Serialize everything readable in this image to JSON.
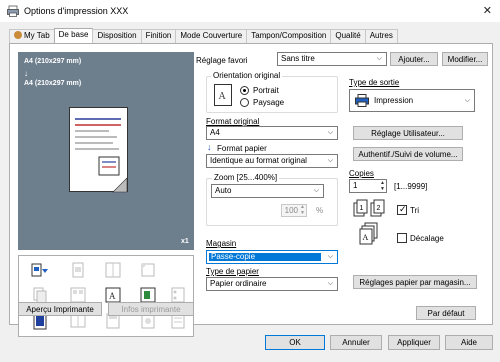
{
  "window": {
    "title": "Options d'impression XXX",
    "close_glyph": "✕"
  },
  "tabs": [
    {
      "label": "My Tab"
    },
    {
      "label": "De base"
    },
    {
      "label": "Disposition"
    },
    {
      "label": "Finition"
    },
    {
      "label": "Mode Couverture"
    },
    {
      "label": "Tampon/Composition"
    },
    {
      "label": "Qualité"
    },
    {
      "label": "Autres"
    }
  ],
  "preview": {
    "paper_label_1": "A4 (210x297 mm)",
    "paper_label_2": "A4 (210x297 mm)",
    "copies_badge": "x1"
  },
  "left_buttons": {
    "preview_printer": "Aperçu Imprimante",
    "printer_info": "Infos imprimante"
  },
  "favorite": {
    "label": "Réglage favori",
    "value": "Sans titre",
    "add": "Ajouter...",
    "modify": "Modifier..."
  },
  "orientation": {
    "title": "Orientation original",
    "portrait": "Portrait",
    "landscape": "Paysage",
    "selected": "Portrait"
  },
  "original_size": {
    "label": "Format original",
    "value": "A4"
  },
  "paper_size": {
    "label": "Format papier",
    "value": "Identique au format original"
  },
  "zoom": {
    "label": "Zoom [25...400%]",
    "value": "Auto",
    "percent_value": "100",
    "percent_unit": "%"
  },
  "tray": {
    "label": "Magasin",
    "value": "Passe-copie"
  },
  "paper_type": {
    "label": "Type de papier",
    "value": "Papier ordinaire"
  },
  "output": {
    "label": "Type de sortie",
    "value": "Impression"
  },
  "user_settings": "Réglage Utilisateur...",
  "auth": "Authentif./Suivi de volume...",
  "copies": {
    "label": "Copies",
    "value": "1",
    "range": "[1...9999]"
  },
  "collate": {
    "label": "Tri",
    "checked": true
  },
  "offset": {
    "label": "Décalage",
    "checked": false
  },
  "tray_paper_settings": "Réglages papier par magasin...",
  "default_button": "Par défaut",
  "footer": {
    "ok": "OK",
    "cancel": "Annuler",
    "apply": "Appliquer",
    "help": "Aide"
  },
  "colors": {
    "preview_bg": "#6d7e8d",
    "selection_blue": "#0078d7",
    "accent_blue": "#1f5fbf"
  }
}
